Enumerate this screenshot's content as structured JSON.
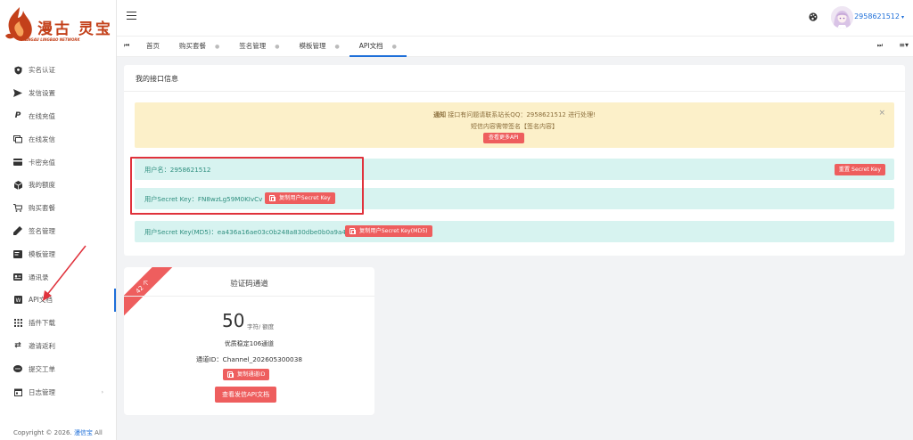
{
  "brand": {
    "name": "漫古 灵宝",
    "sub": "MANGAU LINGBAO NETWORK"
  },
  "sidebar": {
    "items": [
      {
        "label": "实名认证",
        "icon": "shield-icon"
      },
      {
        "label": "发信设置",
        "icon": "send-icon"
      },
      {
        "label": "在线充值",
        "icon": "paypal-icon"
      },
      {
        "label": "在线发信",
        "icon": "chat-icon"
      },
      {
        "label": "卡密充值",
        "icon": "card-icon"
      },
      {
        "label": "我的额度",
        "icon": "cube-icon"
      },
      {
        "label": "购买套餐",
        "icon": "cart-icon"
      },
      {
        "label": "签名管理",
        "icon": "pen-icon"
      },
      {
        "label": "模板管理",
        "icon": "template-icon"
      },
      {
        "label": "通讯录",
        "icon": "contact-card-icon"
      },
      {
        "label": "API文档",
        "icon": "doc-icon"
      },
      {
        "label": "插件下载",
        "icon": "grid-icon"
      },
      {
        "label": "邀请返利",
        "icon": "refresh-icon"
      },
      {
        "label": "提交工单",
        "icon": "message-icon"
      },
      {
        "label": "日志管理",
        "icon": "calendar-icon"
      }
    ],
    "active_index": 10,
    "footer_prefix": "Copyright © 2026.",
    "footer_link": "漫信宝",
    "footer_suffix": "All"
  },
  "header": {
    "username": "2958621512"
  },
  "tabs": {
    "items": [
      {
        "label": "首页",
        "closable": false
      },
      {
        "label": "购买套餐",
        "closable": true
      },
      {
        "label": "签名管理",
        "closable": true
      },
      {
        "label": "模板管理",
        "closable": true
      },
      {
        "label": "API文档",
        "closable": true
      }
    ],
    "active_index": 4
  },
  "info_card": {
    "title": "我的接口信息",
    "notice": {
      "prefix": "通知",
      "line1": "接口有问题请联系站长QQ：2958621512 进行处理!",
      "line2": "短信内容需带签名【签名内容】",
      "button": "查看更多API"
    },
    "username_label": "用户名：2958621512",
    "reset_button": "重置 Secret Key",
    "secret_key_label": "用户Secret Key：FN8wzLg59M0KIvCv",
    "copy_secret_button": "复制用户Secret Key",
    "secret_md5_label": "用户Secret Key(MD5)：ea436a16ae03c0b248a830dbe0b0a9a4",
    "copy_md5_button": "复制用户Secret Key(MD5)"
  },
  "channel_card": {
    "ribbon": "42 个",
    "title": "验证码通道",
    "count": "50",
    "unit": "字符/ 额度",
    "desc": "优质稳定106通道",
    "channel_id": "通道ID：Channel_202605300038",
    "copy_button": "复制通道ID",
    "doc_button": "查看发信API文档"
  },
  "colors": {
    "accent_blue": "#1e6fd9",
    "danger_red": "#ee5e5e",
    "notice_bg": "#fcf0c9",
    "row_bg": "#d7f3f0",
    "highlight": "#e0323c"
  }
}
